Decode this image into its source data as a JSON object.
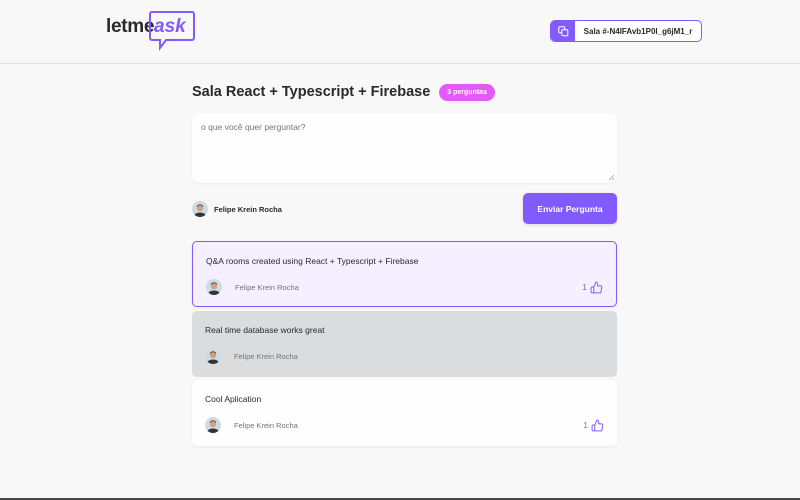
{
  "app": {
    "logo_text": "letme",
    "logo_accent": "ask"
  },
  "room_code": {
    "label": "Sala #-N4IFAvb1P0l_g6jM1_r"
  },
  "room": {
    "title": "Sala React + Typescript + Firebase",
    "badge": "3 perguntas"
  },
  "form": {
    "placeholder": "o que você quer perguntar?",
    "author": "Felipe Krein Rocha",
    "submit_label": "Enviar Pergunta"
  },
  "questions": [
    {
      "content": "Q&A rooms created using React + Typescript + Firebase",
      "author": "Felipe Krein Rocha",
      "likes": "1",
      "state": "highlighted"
    },
    {
      "content": "Real time database works great",
      "author": "Felipe Krein Rocha",
      "state": "answered"
    },
    {
      "content": "Cool Aplication",
      "author": "Felipe Krein Rocha",
      "likes": "1",
      "state": "liked"
    }
  ],
  "colors": {
    "accent": "#835afd",
    "badge": "#e559f9",
    "background": "#f8f8f8",
    "answered": "#dbdcdd",
    "highlighted": "#f4f0ff"
  },
  "icons": [
    "copy-icon",
    "like-icon",
    "avatar"
  ]
}
